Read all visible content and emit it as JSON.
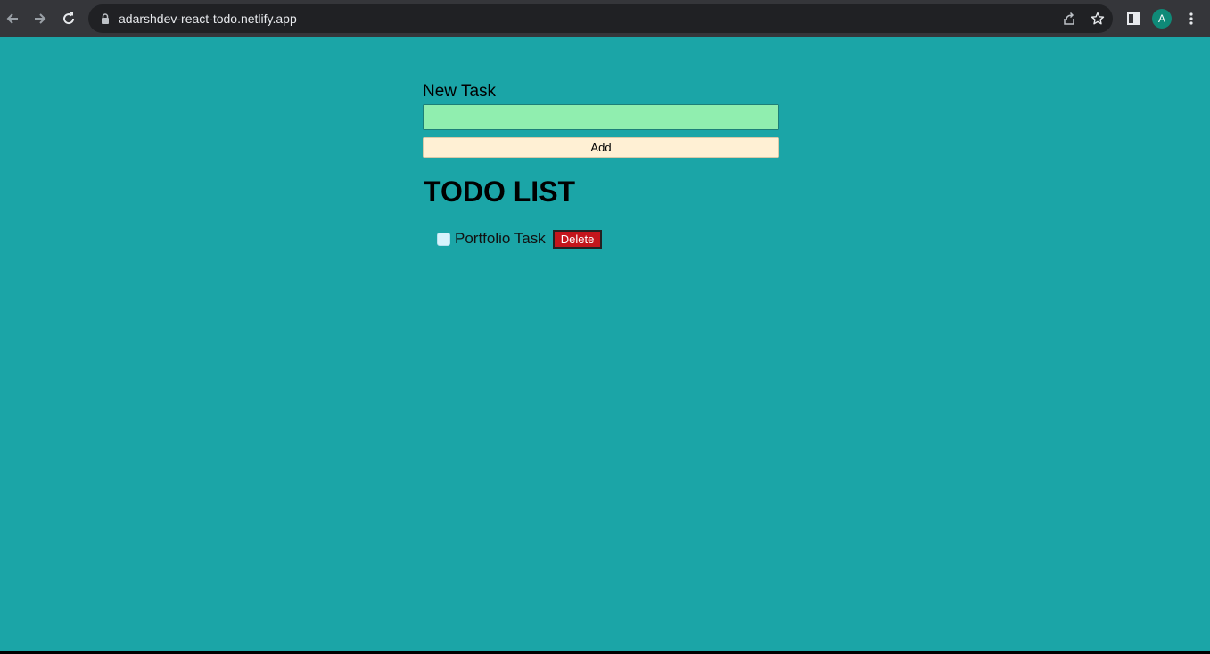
{
  "browser": {
    "url": "adarshdev-react-todo.netlify.app",
    "profile_initial": "A",
    "icons": {
      "back": "back-arrow-icon",
      "forward": "forward-arrow-icon",
      "reload": "reload-icon",
      "lock": "lock-icon",
      "share": "share-icon",
      "bookmark": "star-icon",
      "side_panel": "side-panel-icon",
      "menu": "kebab-menu-icon"
    }
  },
  "app": {
    "background_color": "#1ba5a7",
    "new_task_label": "New Task",
    "new_task_value": "",
    "add_button_label": "Add",
    "list_title": "TODO LIST",
    "todos": [
      {
        "text": "Portfolio Task",
        "completed": false,
        "delete_label": "Delete"
      }
    ]
  }
}
